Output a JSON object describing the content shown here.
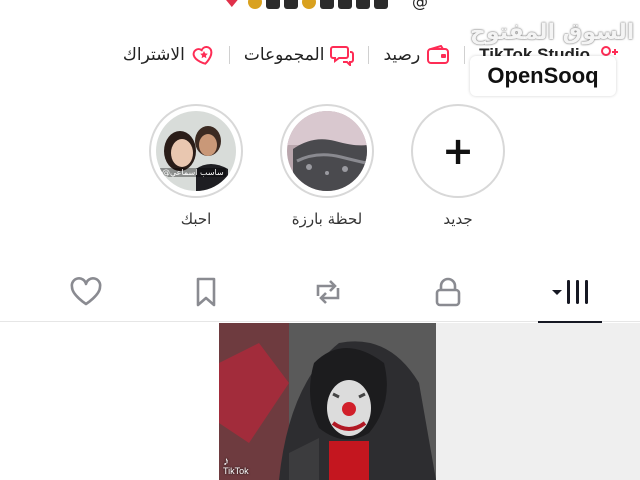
{
  "bio": {
    "tail": "@"
  },
  "links": [
    {
      "id": "tiktok-studio",
      "label": "TikTok Studio",
      "icon": "person-add-icon"
    },
    {
      "id": "balance",
      "label": "رصيد",
      "icon": "wallet-icon"
    },
    {
      "id": "groups",
      "label": "المجموعات",
      "icon": "chat-bubbles-icon"
    },
    {
      "id": "subscription",
      "label": "الاشتراك",
      "icon": "heart-star-icon"
    }
  ],
  "watermark": {
    "arabic": "السوق المفتوح",
    "brand": "OpenSooq"
  },
  "highlights": [
    {
      "label": "جديد",
      "icon": "plus-icon"
    },
    {
      "label": "لحظة بارزة"
    },
    {
      "label": "احبك",
      "caption": "ساسب اسماعي@"
    }
  ],
  "tabs": [
    {
      "id": "videos",
      "icon": "grid-icon",
      "active": true
    },
    {
      "id": "private",
      "icon": "lock-icon",
      "active": false
    },
    {
      "id": "reposts",
      "icon": "repost-icon",
      "active": false
    },
    {
      "id": "favorites",
      "icon": "bookmark-icon",
      "active": false
    },
    {
      "id": "liked",
      "icon": "heart-outline-icon",
      "active": false
    }
  ],
  "video": {
    "mark": "TikTok"
  },
  "colors": {
    "accent": "#fe2c55",
    "text": "#161823",
    "divider": "#e6e6e6"
  }
}
